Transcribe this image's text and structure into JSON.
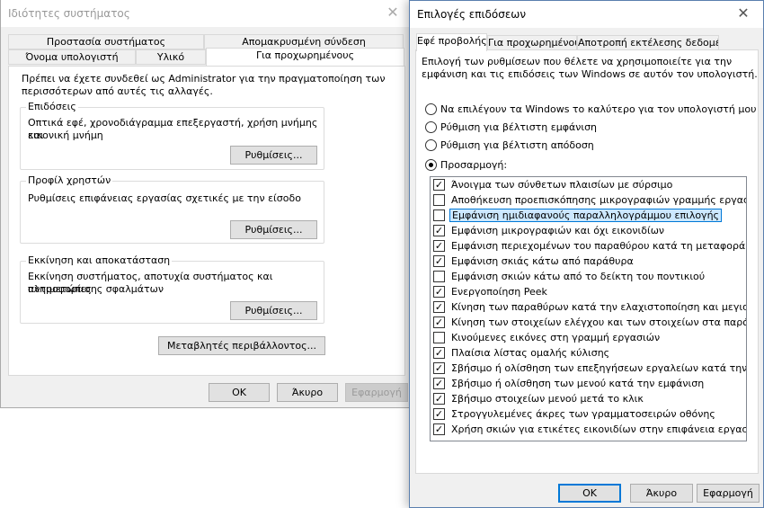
{
  "system_properties": {
    "title": "Ιδιότητες συστήματος",
    "close_glyph": "✕",
    "tabs_top": [
      "Προστασία συστήματος",
      "Απομακρυσμένη σύνδεση"
    ],
    "tabs_bottom": [
      "Όνομα υπολογιστή",
      "Υλικό",
      "Για προχωρημένους"
    ],
    "admin_notice": [
      "Πρέπει να έχετε συνδεθεί ως Administrator για την πραγματοποίηση των",
      "περισσότερων από αυτές τις αλλαγές."
    ],
    "performance": {
      "label": "Επιδόσεις",
      "desc": [
        "Οπτικά εφέ, χρονοδιάγραμμα επεξεργαστή, χρήση μνήμης και",
        "εικονική μνήμη"
      ],
      "button": "Ρυθμίσεις..."
    },
    "user_profiles": {
      "label": "Προφίλ χρηστών",
      "desc": [
        "Ρυθμίσεις επιφάνειας εργασίας σχετικές με την είσοδο"
      ],
      "button": "Ρυθμίσεις..."
    },
    "startup_recovery": {
      "label": "Εκκίνηση και αποκατάσταση",
      "desc": [
        "Εκκίνηση συστήματος, αποτυχία συστήματος και πληροφορίες",
        "αντιμετώπισης σφαλμάτων"
      ],
      "button": "Ρυθμίσεις..."
    },
    "env_button": "Μεταβλητές περιβάλλοντος...",
    "ok": "ΟΚ",
    "cancel": "Άκυρο",
    "apply": "Εφαρμογή"
  },
  "performance_options": {
    "title": "Επιλογές επιδόσεων",
    "close_glyph": "✕",
    "tabs": [
      "Εφέ προβολής",
      "Για προχωρημένους",
      "Αποτροπή εκτέλεσης δεδομένων"
    ],
    "intro": [
      "Επιλογή των ρυθμίσεων που θέλετε να χρησιμοποιείτε για την",
      "εμφάνιση και τις επιδόσεις των Windows σε αυτόν τον υπολογιστή."
    ],
    "radios": [
      {
        "label": "Να επιλέγουν τα Windows το καλύτερο για τον υπολογιστή μου",
        "selected": false
      },
      {
        "label": "Ρύθμιση για βέλτιστη εμφάνιση",
        "selected": false
      },
      {
        "label": "Ρύθμιση για βέλτιστη απόδοση",
        "selected": false
      },
      {
        "label": "Προσαρμογή:",
        "selected": true
      }
    ],
    "check_glyph": "✓",
    "effects": [
      {
        "label": "Άνοιγμα των σύνθετων πλαισίων με σύρσιμο",
        "checked": true
      },
      {
        "label": "Αποθήκευση προεπισκόπησης μικρογραφιών γραμμής εργασιών",
        "checked": false
      },
      {
        "label": "Εμφάνιση ημιδιαφανούς παραλληλογράμμου επιλογής",
        "checked": false,
        "selected": true
      },
      {
        "label": "Εμφάνιση μικρογραφιών και όχι εικονιδίων",
        "checked": true
      },
      {
        "label": "Εμφάνιση περιεχομένων του παραθύρου κατά τη μεταφορά",
        "checked": true
      },
      {
        "label": "Εμφάνιση σκιάς κάτω από παράθυρα",
        "checked": true
      },
      {
        "label": "Εμφάνιση σκιών κάτω από το δείκτη του ποντικιού",
        "checked": false
      },
      {
        "label": "Ενεργοποίηση Peek",
        "checked": true
      },
      {
        "label": "Κίνηση των παραθύρων κατά την ελαχιστοποίηση και μεγιστοπο",
        "checked": true
      },
      {
        "label": "Κίνηση των στοιχείων ελέγχου και των στοιχείων στα παράθυρα",
        "checked": true
      },
      {
        "label": "Κινούμενες εικόνες στη γραμμή εργασιών",
        "checked": false
      },
      {
        "label": "Πλαίσια λίστας ομαλής κύλισης",
        "checked": true
      },
      {
        "label": "Σβήσιμο ή ολίσθηση των επεξηγήσεων εργαλείων κατά την εμφά",
        "checked": true
      },
      {
        "label": "Σβήσιμο ή ολίσθηση των μενού κατά την εμφάνιση",
        "checked": true
      },
      {
        "label": "Σβήσιμο στοιχείων μενού μετά το κλικ",
        "checked": true
      },
      {
        "label": "Στρογγυλεμένες άκρες των γραμματοσειρών οθόνης",
        "checked": true
      },
      {
        "label": "Χρήση σκιών για ετικέτες εικονιδίων στην επιφάνεια εργασίας",
        "checked": true
      }
    ],
    "ok": "ΟΚ",
    "cancel": "Άκυρο",
    "apply": "Εφαρμογή"
  }
}
